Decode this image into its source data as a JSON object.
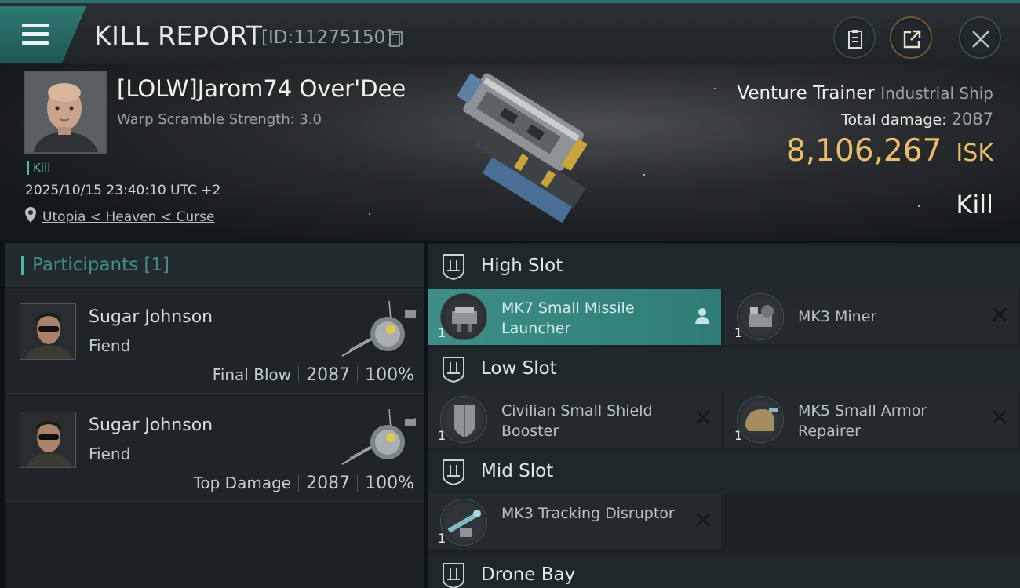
{
  "header": {
    "title": "KILL REPORT",
    "report_id": "[ID:11275150]",
    "icons": [
      "menu-icon",
      "copy-icon",
      "clipboard-icon",
      "share-icon",
      "close-icon"
    ]
  },
  "victim": {
    "name": "[LOLW]Jarom74 Over'Dee",
    "warp_scramble": "Warp Scramble Strength: 3.0",
    "tag": "Kill",
    "datetime": "2025/10/15 23:40:10 UTC +2",
    "location": "Utopia < Heaven < Curse",
    "ship_name": "Venture Trainer",
    "ship_class": "Industrial Ship",
    "total_damage_label": "Total damage:",
    "total_damage": "2087",
    "isk_value": "8,106,267",
    "isk_unit": "ISK",
    "result": "Kill"
  },
  "participants": {
    "title": "Participants [1]",
    "items": [
      {
        "name": "Sugar Johnson",
        "ship": "Fiend",
        "role": "Final Blow",
        "damage": "2087",
        "percent": "100%"
      },
      {
        "name": "Sugar Johnson",
        "ship": "Fiend",
        "role": "Top Damage",
        "damage": "2087",
        "percent": "100%"
      }
    ]
  },
  "fitting": {
    "high": {
      "label": "High Slot",
      "modules": [
        {
          "name": "MK7 Small Missile Launcher",
          "qty": "1"
        },
        {
          "name": "MK3 Miner",
          "qty": "1"
        }
      ]
    },
    "low": {
      "label": "Low Slot",
      "modules": [
        {
          "name": "Civilian Small Shield Booster",
          "qty": "1"
        },
        {
          "name": "MK5 Small Armor Repairer",
          "qty": "1"
        }
      ]
    },
    "mid": {
      "label": "Mid Slot",
      "modules": [
        {
          "name": "MK3 Tracking Disruptor",
          "qty": "1"
        }
      ]
    },
    "drone": {
      "label": "Drone Bay"
    }
  },
  "colors": {
    "accent": "#4fb4ad",
    "isk": "#e9bd6c",
    "active_module": "#3d8f87"
  }
}
